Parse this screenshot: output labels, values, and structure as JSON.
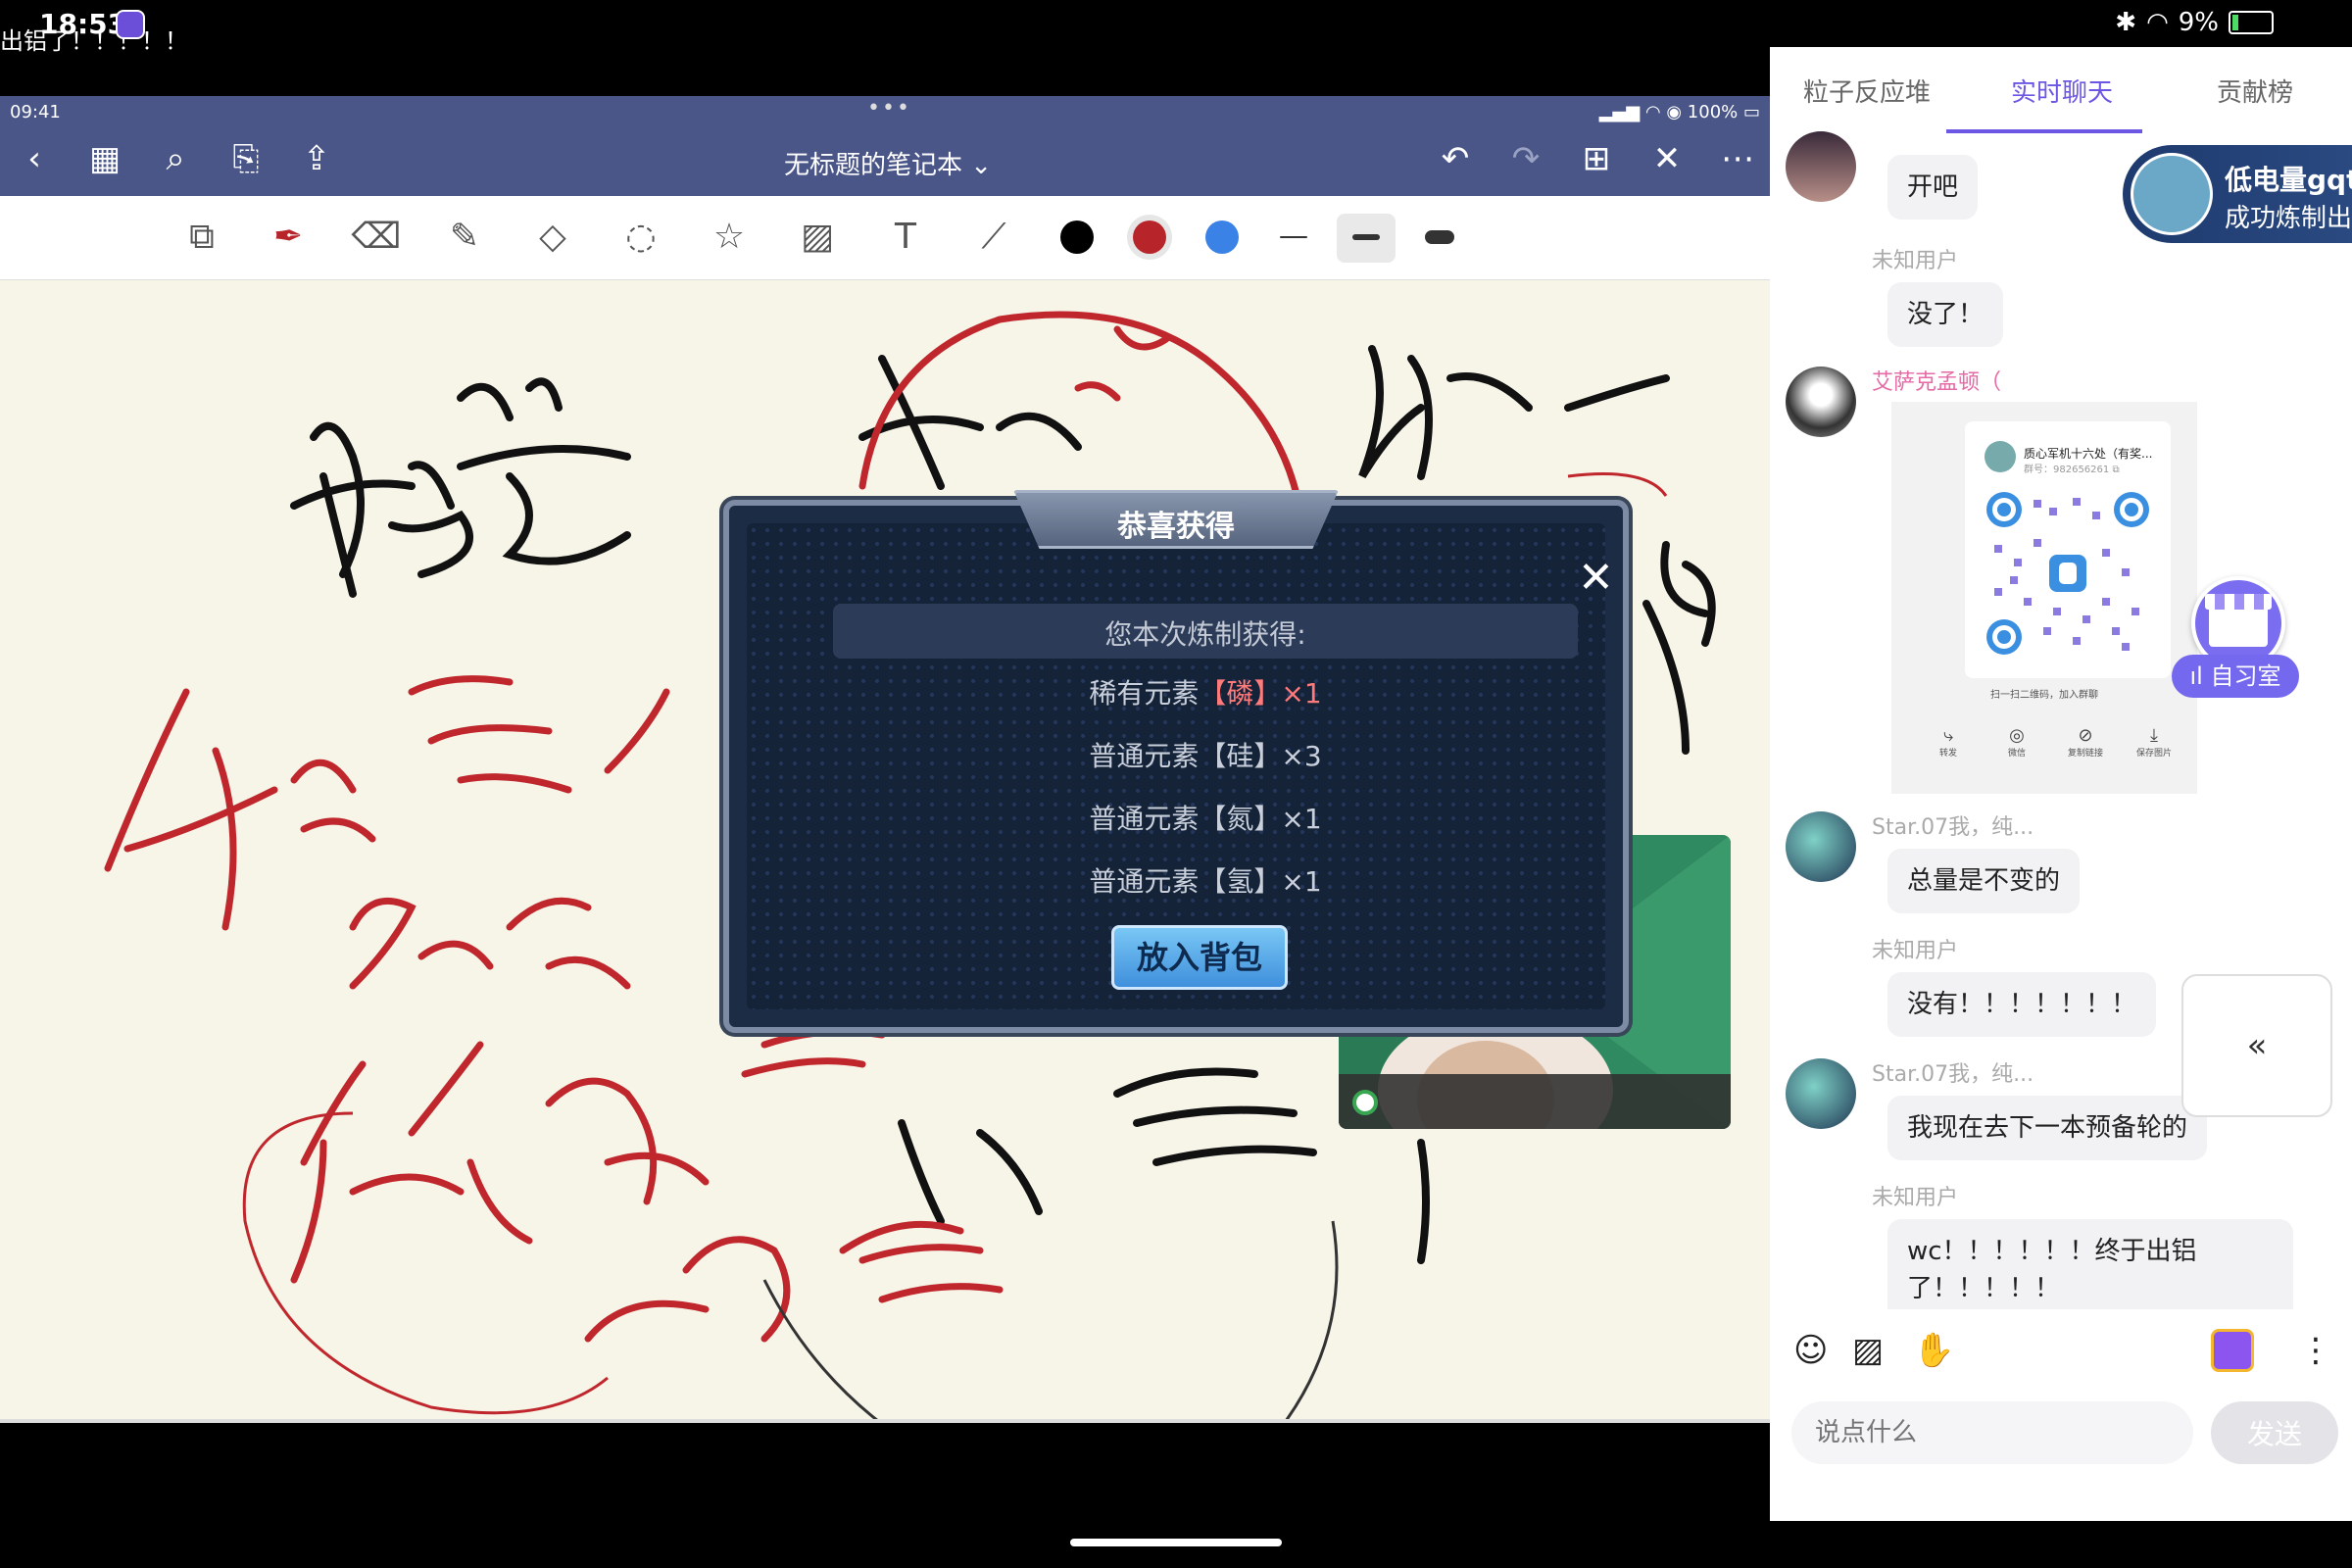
{
  "status_bar": {
    "ticker": "出铝了！！！！！",
    "time": "18:53",
    "battery": "9%"
  },
  "notes_app": {
    "ipad_time": "09:41",
    "ipad_battery": "100%",
    "notebook_title": "无标题的笔记本",
    "title_chevron": "⌄",
    "icons": {
      "back": "‹",
      "grid": "▦",
      "search": "⌕",
      "bookmark": "⎘",
      "share": "⇪",
      "undo": "↶",
      "redo": "↷",
      "add_page": "⊞",
      "close": "✕",
      "more": "⋯"
    },
    "tools": [
      "layout-icon",
      "pen-icon",
      "eraser-icon",
      "highlighter-icon",
      "shapes-icon",
      "lasso-icon",
      "sticker-icon",
      "image-icon",
      "text-icon",
      "laser-icon"
    ],
    "colors": [
      "#000000",
      "#b7242a",
      "#3b82e6"
    ]
  },
  "dialog": {
    "title": "恭喜获得",
    "subtitle": "您本次炼制获得:",
    "items": [
      {
        "prefix": "稀有元素",
        "element": "【磷】",
        "qty": "×1",
        "rare": true
      },
      {
        "prefix": "普通元素",
        "element": "【硅】",
        "qty": "×3",
        "rare": false
      },
      {
        "prefix": "普通元素",
        "element": "【氮】",
        "qty": "×1",
        "rare": false
      },
      {
        "prefix": "普通元素",
        "element": "【氢】",
        "qty": "×1",
        "rare": false
      }
    ],
    "button": "放入背包",
    "close_icon": "✕"
  },
  "chat": {
    "tabs": [
      "粒子反应堆",
      "实时聊天",
      "贡献榜"
    ],
    "active_tab": 1,
    "banner": {
      "line1": "低电量gqti",
      "line2": "成功炼制出"
    },
    "messages": [
      {
        "user": "未知用户",
        "text": "没了！"
      },
      {
        "user": "艾萨克孟顿（",
        "text": ""
      },
      {
        "user": "Star.07我，纯...",
        "text": "总量是不变的"
      },
      {
        "user": "未知用户",
        "text": "没有！！！！！！！"
      },
      {
        "user": "Star.07我，纯...",
        "text": "我现在去下一本预备轮的"
      },
      {
        "user": "未知用户",
        "text": "wc！！！！！！终于出铝了！！！！！"
      }
    ],
    "first_bubble": "开吧",
    "qr": {
      "group_name": "质心军机十六处（有奖...",
      "group_id": "群号：982656261 ⧉",
      "caption": "扫一扫二维码，加入群聊",
      "actions": [
        "转发",
        "微信",
        "复制链接",
        "保存图片"
      ]
    },
    "study_room": "ıl 自习室",
    "collapse_icon": "«",
    "input_placeholder": "说点什么",
    "send_label": "发送"
  }
}
